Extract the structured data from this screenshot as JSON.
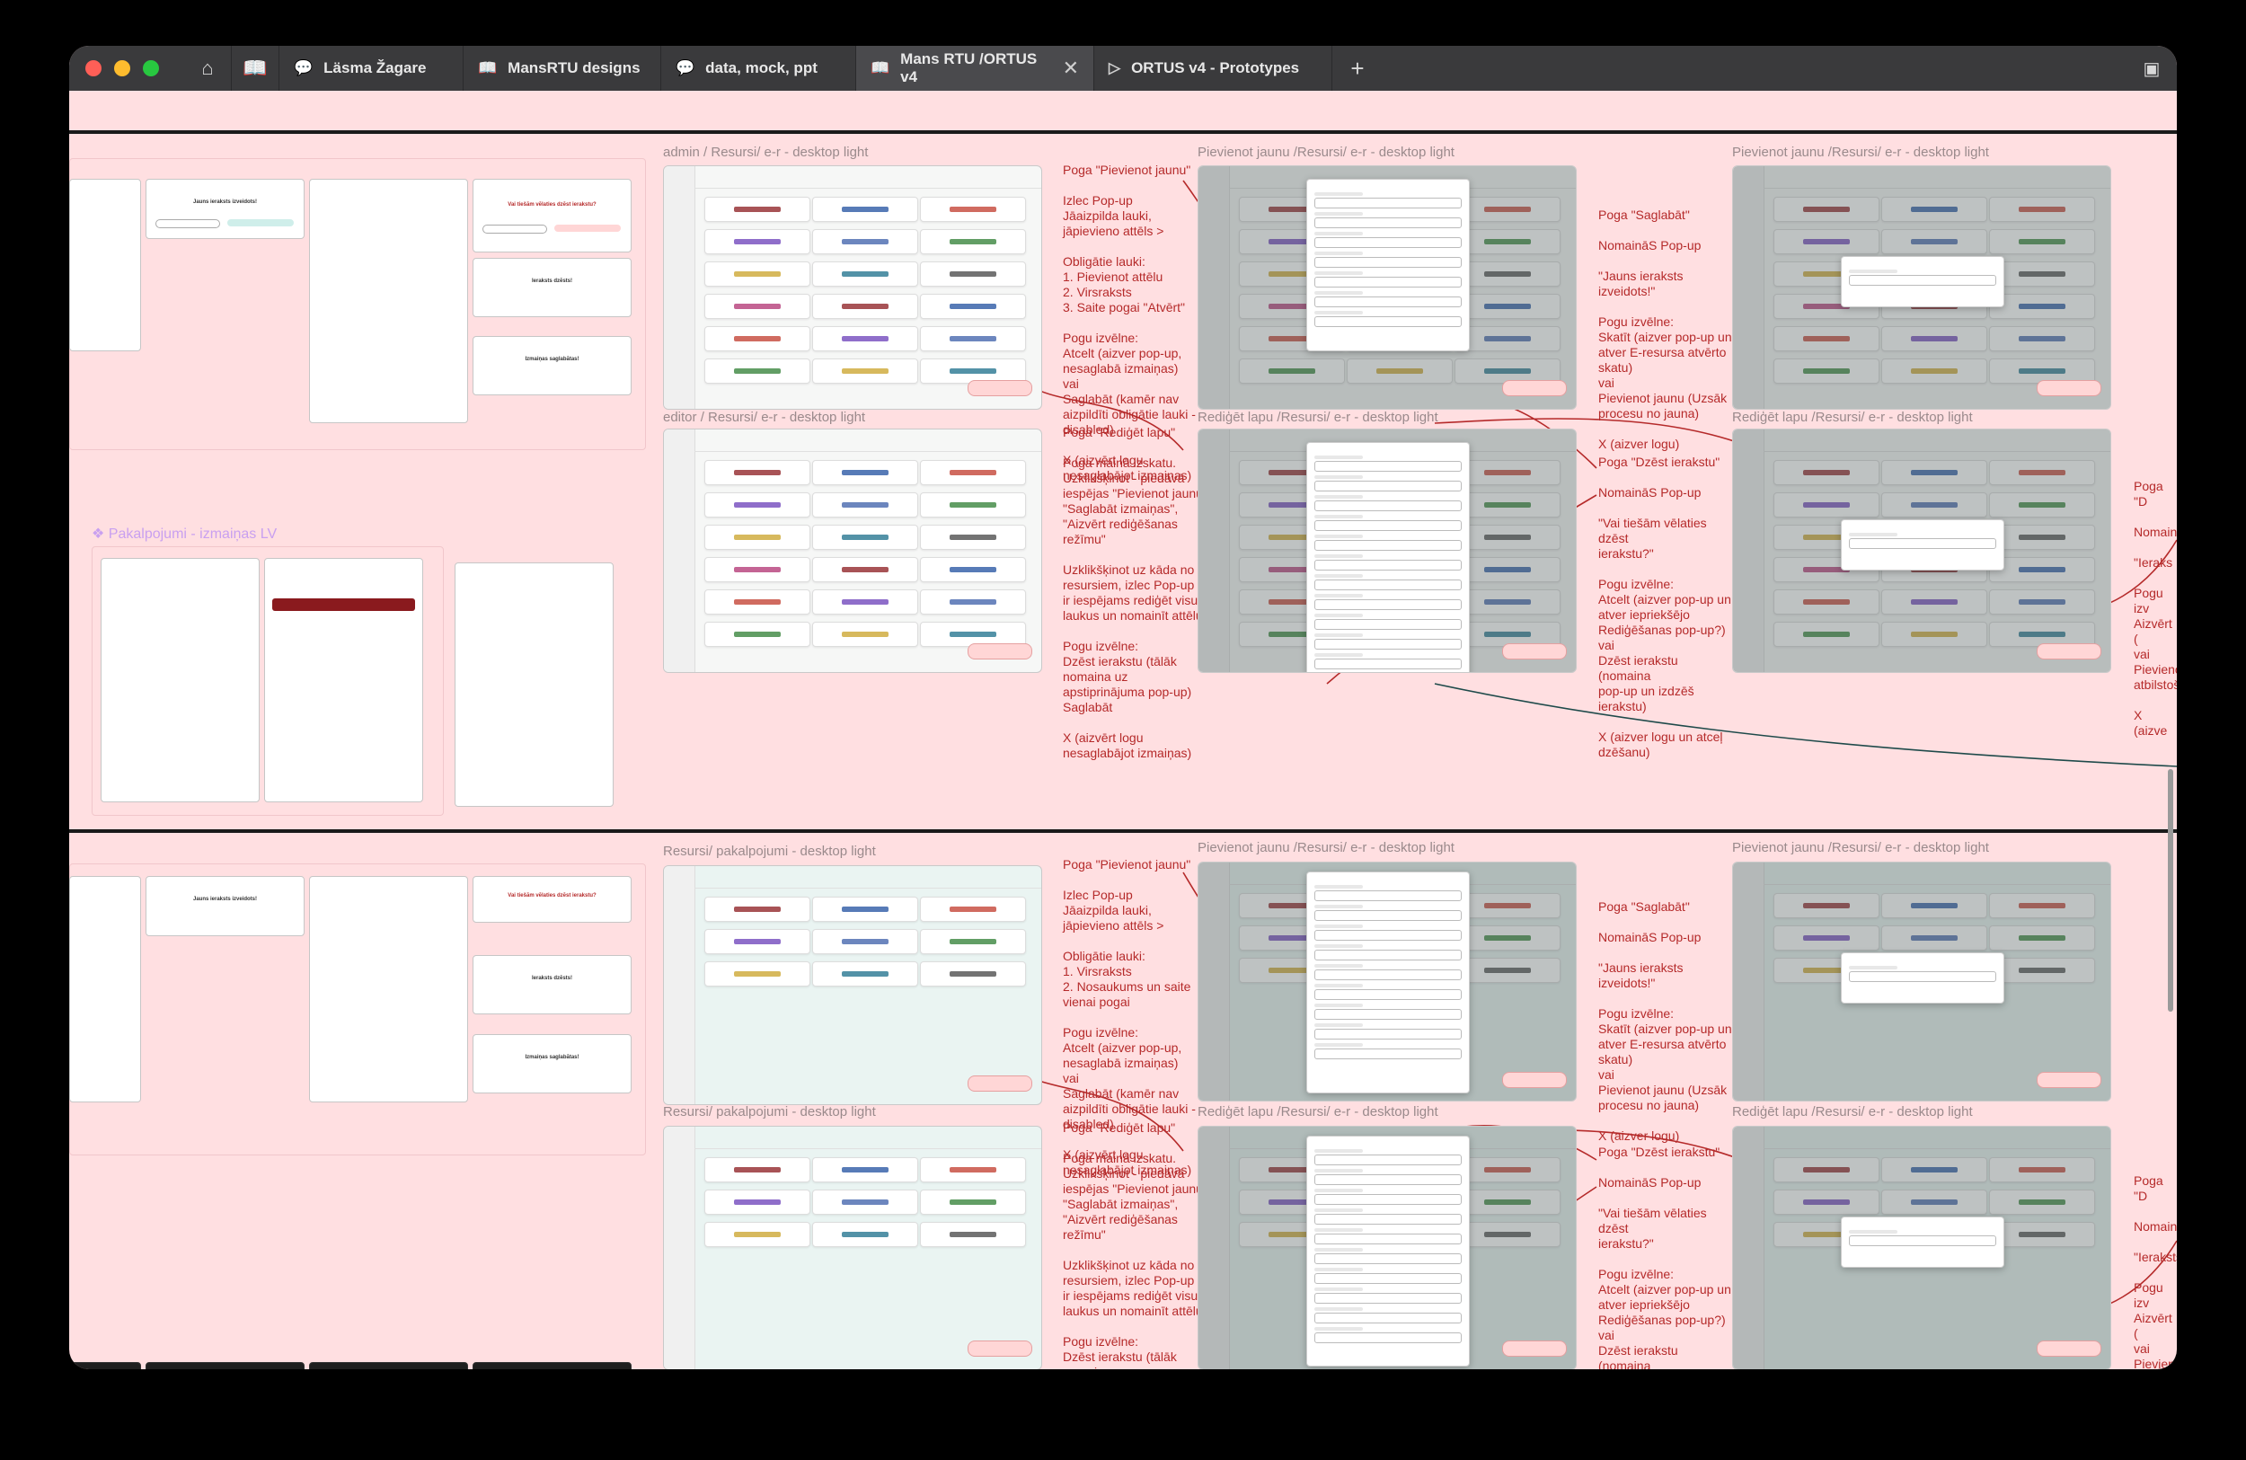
{
  "tabs": [
    {
      "label": "Läsma Žagare",
      "icon": "chat-icon"
    },
    {
      "label": "MansRTU designs",
      "icon": "book-icon"
    },
    {
      "label": "data, mock, ppt",
      "icon": "chat-icon"
    },
    {
      "label": "Mans RTU /ORTUS v4",
      "icon": "book-icon",
      "active": true
    },
    {
      "label": "ORTUS v4 - Prototypes",
      "icon": "play-icon"
    }
  ],
  "section_label": "❖ Pakalpojumi - izmaiņas LV",
  "frame_labels": {
    "admin": "admin / Resursi/ e-r - desktop light",
    "editor": "editor / Resursi/ e-r - desktop light",
    "pj1": "Pievienot jaunu /Resursi/ e-r - desktop light",
    "pj2": "Pievienot jaunu /Resursi/ e-r - desktop light",
    "rl1": "Rediģēt lapu /Resursi/ e-r - desktop light",
    "rl2": "Rediģēt lapu /Resursi/ e-r - desktop light",
    "rp1": "Resursi/ pakalpojumi - desktop light",
    "rp2": "Resursi/ pakalpojumi - desktop light",
    "pj3": "Pievienot jaunu /Resursi/ e-r - desktop light",
    "pj4": "Pievienot jaunu /Resursi/ e-r - desktop light",
    "rl3": "Rediģēt lapu /Resursi/ e-r - desktop light",
    "rl4": "Rediģēt lapu /Resursi/ e-r - desktop light"
  },
  "modal_titles": {
    "created": "Jauns ieraksts izveidots!",
    "delete": "Vai tiešām vēlaties dzēst ierakstu?",
    "deleted": "Ieraksts dzēsts!",
    "saved": "Izmaiņas saglabātas!"
  },
  "annotations": {
    "a1": "Poga \"Pievienot jaunu\"\n\nIzlec Pop-up\nJāaizpilda lauki,\njāpievieno attēls >\n\nObligātie lauki:\n 1. Pievienot attēlu\n 2. Virsraksts\n 3. Saite pogai \"Atvērt\"\n\nPogu izvēlne:\nAtcelt (aizver pop-up,\nnesaglabā izmaiņas)\nvai\nSaglabāt (kamēr nav\naizpildīti obligātie lauki -\ndisabled)\n\nX (aizvērt logu\nnesaglabājot izmaiņas)",
    "a2": "Poga \"Rediģēt lapu\"\n\nPoga mainā izskatu.\nUzklikšķinot - piedāvā\niespējas \"Pievienot jaunu\",\n\"Saglabāt izmaiņas\",\n\"Aizvērt rediģēšanas\nrežīmu\"\n\nUzklikšķinot uz kāda no\nresursiem, izlec Pop-up un\nir iespējams rediģēt visus\nlaukus un nomainīt attēlu.\n\nPogu izvēlne:\nDzēst ierakstu (tālāk\nnomaina uz\napstiprinājuma pop-up)\nSaglabāt\n\nX (aizvērt logu\nnesaglabājot izmaiņas)",
    "a3": "Poga \"Saglabāt\"\n\nNomaināS Pop-up\n\n\"Jauns ieraksts izveidots!\"\n\nPogu izvēlne:\nSkatīt (aizver pop-up un\natver E-resursa atvērto\nskatu)\nvai\nPievienot jaunu (Uzsāk\nprocesu no jauna)\n\nX (aizver logu)",
    "a4": "Poga \"Dzēst ierakstu\"\n\nNomaināS Pop-up\n\n\"Vai tiešām vēlaties dzēst\nierakstu?\"\n\nPogu izvēlne:\nAtcelt (aizver pop-up un\natver iepriekšējo\nRediģēšanas pop-up?)\nvai\nDzēst ierakstu (nomaina\npop-up un izdzēš ierakstu)\n\nX (aizver logu un atceļ\ndzēšanu)",
    "a5": "Poga \"Pievienot jaunu\"\n\nIzlec Pop-up\nJāaizpilda lauki,\njāpievieno attēls >\n\nObligātie lauki:\n 1. Virsraksts\n 2. Nosaukums un saite\n     vienai pogai\n\nPogu izvēlne:\nAtcelt (aizver pop-up,\nnesaglabā izmaiņas)\nvai\nSaglabāt (kamēr nav\naizpildīti obligātie lauki -\ndisabled)\n\nX (aizvērt logu\nnesaglabājot izmaiņas)",
    "a6": "Poga \"Rediģēt lapu\"\n\nPoga mainā izskatu.\nUzklikšķinot - piedāvā\niespējas \"Pievienot jaunu\",\n\"Saglabāt izmaiņas\",\n\"Aizvērt rediģēšanas\nrežīmu\"\n\nUzklikšķinot uz kāda no\nresursiem, izlec Pop-up un\nir iespējams rediģēt visus\nlaukus un nomainīt attēlu.\n\nPogu izvēlne:\nDzēst ierakstu (tālāk\nnomaina uz\napstiprinājuma pop-up)\nSaglabāt\n\nX (aizvērt logu",
    "a7": "Poga \"Saglabāt\"\n\nNomaināS Pop-up\n\n\"Jauns ieraksts izveidots!\"\n\nPogu izvēlne:\nSkatīt (aizver pop-up un\natver E-resursa atvērto\nskatu)\nvai\nPievienot jaunu (Uzsāk\nprocesu no jauna)\n\nX (aizver logu)",
    "a8": "Poga \"Dzēst ierakstu\"\n\nNomaināS Pop-up\n\n\"Vai tiešām vēlaties dzēst\nierakstu?\"\n\nPogu izvēlne:\nAtcelt (aizver pop-up un\natver iepriekšējo\nRediģēšanas pop-up?)\nvai\nDzēst ierakstu (nomaina\npop-up un izdzēš ierakstu)\n\nX (aizver logu un atceļ\ndzēšanu)",
    "r1": "Poga \"D\n\nNomain\n\n\"Ieraks\n\nPogu izv\nAizvērt (\nvai\nPievieno\natbilstoš\n\nX (aizve",
    "r2": "Poga \"D\n\nNomain\n\n\"Ieraksts\n\nPogu izv\nAizvērt (\nvai\nPievieno\natbilstoš\n\nX (aizver"
  }
}
